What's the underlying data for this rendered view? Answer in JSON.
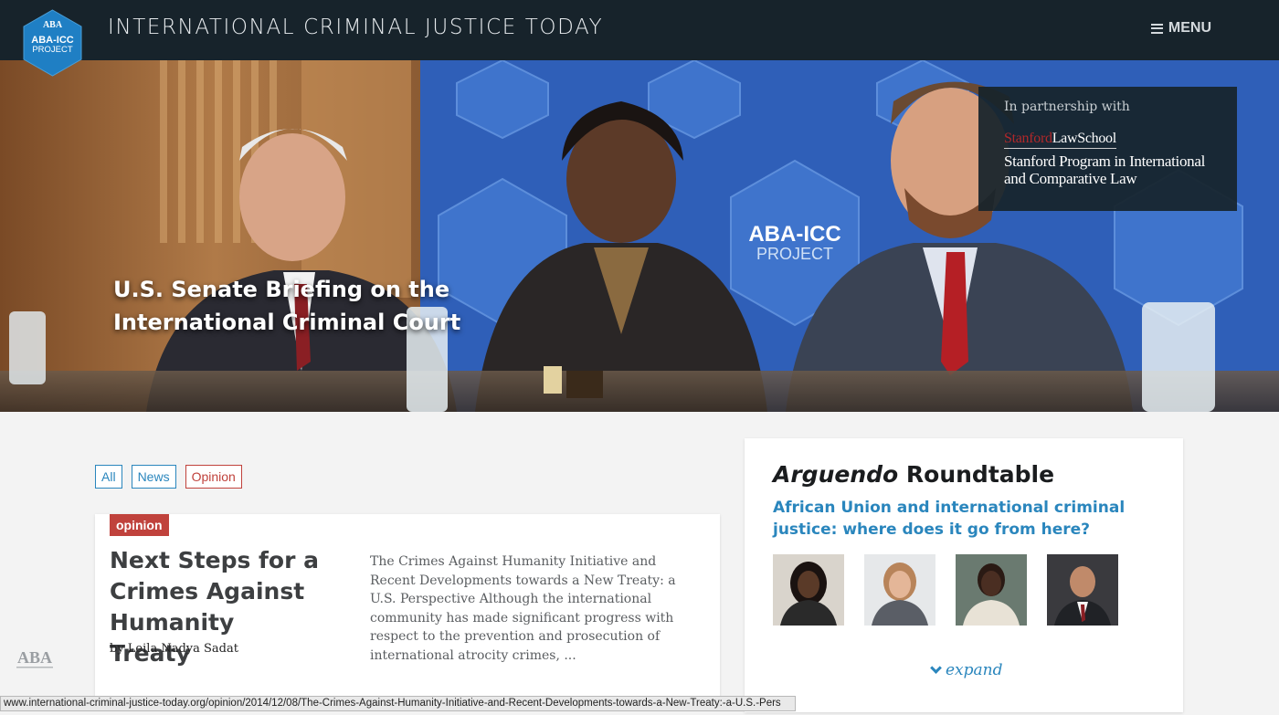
{
  "header": {
    "logo_top": "ABA",
    "logo_main": "ABA-ICC",
    "logo_sub": "PROJECT",
    "site_title": "INTERNATIONAL CRIMINAL JUSTICE TODAY",
    "menu_label": "MENU"
  },
  "hero": {
    "caption": "U.S. Senate Briefing on the International Criminal Court",
    "banner_main": "ABA-ICC",
    "banner_sub": "PROJECT",
    "partner": {
      "intro": "In partnership with",
      "school_red": "Stanford",
      "school_rest": "LawSchool",
      "program": "Stanford Program in International and Comparative Law"
    }
  },
  "filters": [
    "All",
    "News",
    "Opinion"
  ],
  "article": {
    "tag": "opinion",
    "title": "Next Steps for a Crimes Against Humanity Treaty",
    "byline": "by Leila Nadya Sadat",
    "excerpt": "The Crimes Against Humanity Initiative and Recent Developments towards a New Treaty: a U.S. Perspective Although the international community has made significant progress with respect to the prevention and prosecution of international atrocity crimes, ..."
  },
  "roundtable": {
    "title_italic": "Arguendo",
    "title_rest": " Roundtable",
    "subtitle": "African Union and international criminal justice: where does it go from here?",
    "expand_label": "expand"
  },
  "footer": {
    "aba_logo": "ABA"
  },
  "status_url": "www.international-criminal-justice-today.org/opinion/2014/12/08/The-Crimes-Against-Humanity-Initiative-and-Recent-Developments-towards-a-New-Treaty:-a-U.S.-Pers",
  "colors": {
    "header_bg": "#17232b",
    "link_blue": "#2a86bd",
    "opinion_red": "#c0423c",
    "logo_blue": "#1f7fc4"
  },
  "icons": [
    "hamburger-icon",
    "chevron-down-icon",
    "aba-logo-icon"
  ]
}
